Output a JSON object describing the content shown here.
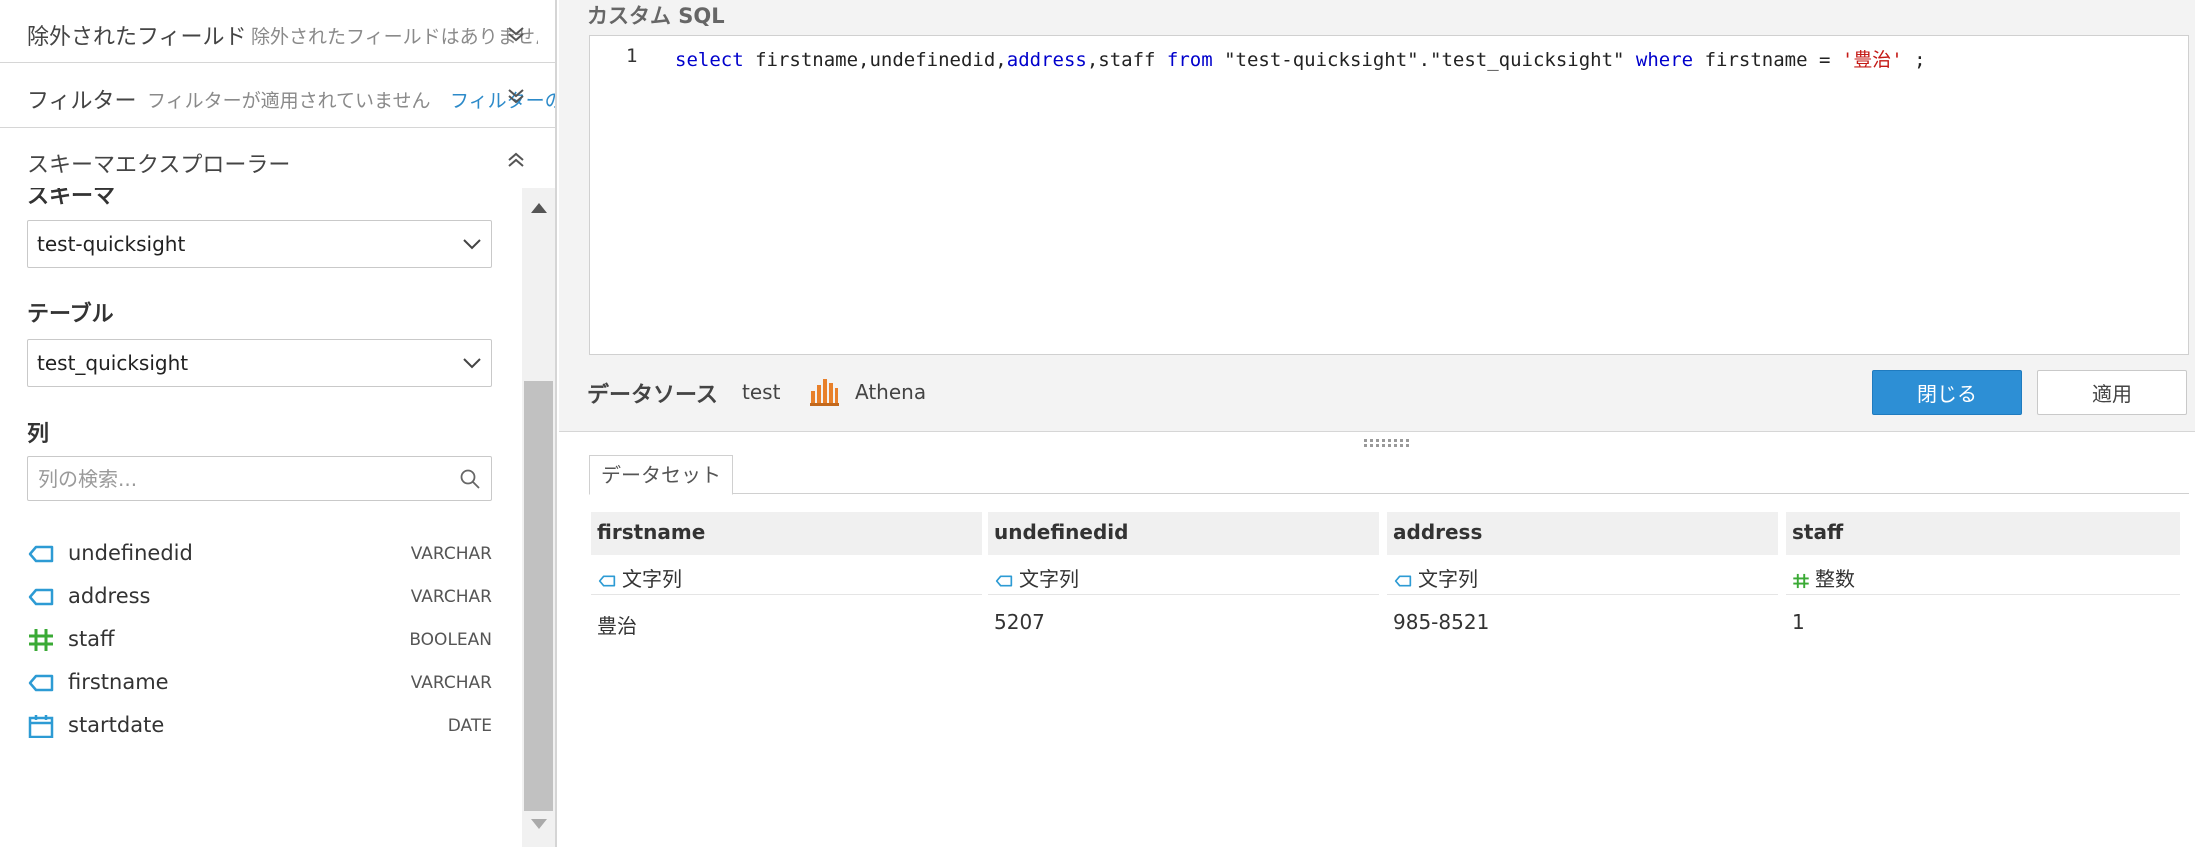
{
  "left_panel": {
    "excluded": {
      "title": "除外されたフィールド",
      "subtitle": "除外されたフィールドはありません"
    },
    "filter": {
      "title": "フィルター",
      "subtitle": "フィルターが適用されていません",
      "link": "フィルターの"
    },
    "schema_explorer": {
      "title": "スキーマエクスプローラー",
      "schema_label": "スキーマ",
      "schema_value": "test-quicksight",
      "table_label": "テーブル",
      "table_value": "test_quicksight",
      "columns_label": "列",
      "search_placeholder": "列の検索...",
      "columns": [
        {
          "name": "undefinedid",
          "type": "VARCHAR",
          "icon": "string-icon"
        },
        {
          "name": "address",
          "type": "VARCHAR",
          "icon": "string-icon"
        },
        {
          "name": "staff",
          "type": "BOOLEAN",
          "icon": "hash-icon"
        },
        {
          "name": "firstname",
          "type": "VARCHAR",
          "icon": "string-icon"
        },
        {
          "name": "startdate",
          "type": "DATE",
          "icon": "calendar-icon"
        }
      ]
    }
  },
  "sql_editor": {
    "title": "カスタム SQL",
    "line_number": "1",
    "tokens": {
      "select": "select",
      "cols1": " firstname,undefinedid,",
      "address": "address",
      "cols2": ",staff ",
      "from": "from",
      "table": " \"test-quicksight\".\"test_quicksight\" ",
      "where": "where",
      "cond": " firstname = ",
      "literal": "'豊治'",
      "end": " ;"
    }
  },
  "datasource": {
    "label": "データソース",
    "name": "test",
    "engine": "Athena"
  },
  "buttons": {
    "close": "閉じる",
    "apply": "適用"
  },
  "preview": {
    "tab": "データセット",
    "columns": [
      {
        "header": "firstname",
        "type": "文字列",
        "type_icon": "string-icon",
        "value": "豊治"
      },
      {
        "header": "undefinedid",
        "type": "文字列",
        "type_icon": "string-icon",
        "value": "5207"
      },
      {
        "header": "address",
        "type": "文字列",
        "type_icon": "string-icon",
        "value": "985-8521"
      },
      {
        "header": "staff",
        "type": "整数",
        "type_icon": "hash-icon",
        "value": "1"
      }
    ]
  },
  "colors": {
    "accent": "#2d8fd5",
    "string_icon": "#2d9bd4",
    "number_icon": "#3aaa35",
    "athena": "#e8802a"
  }
}
